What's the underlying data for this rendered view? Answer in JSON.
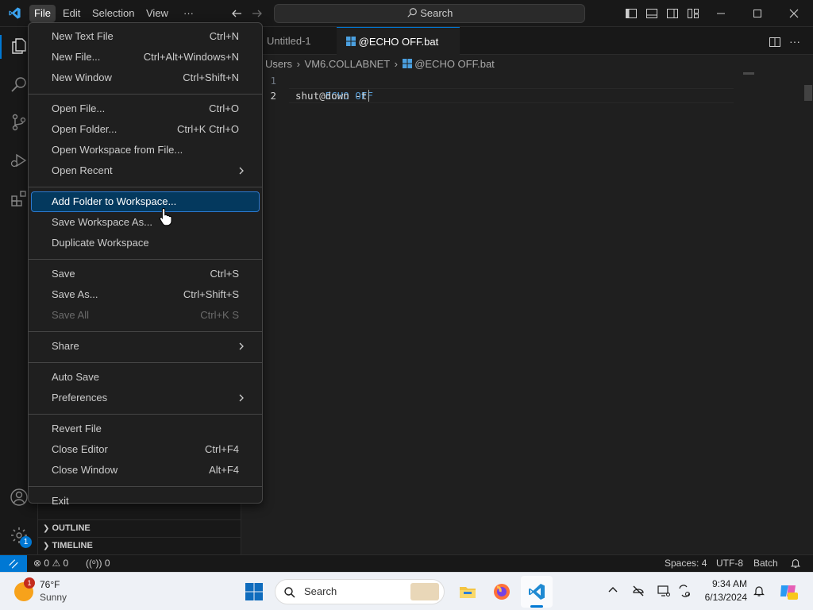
{
  "menubar": {
    "items": [
      {
        "label": "File",
        "active": true
      },
      {
        "label": "Edit"
      },
      {
        "label": "Selection"
      },
      {
        "label": "View"
      },
      {
        "label": "···"
      }
    ],
    "search_label": "Search"
  },
  "tabs": [
    {
      "label": "Untitled-1",
      "active": false
    },
    {
      "label": "@ECHO OFF.bat",
      "active": true
    }
  ],
  "breadcrumb": [
    "Users",
    "VM6.COLLABNET",
    "@ECHO OFF.bat"
  ],
  "editor": {
    "lines": [
      {
        "num": "1",
        "at": "@",
        "kw": "ECHO OFF"
      },
      {
        "num": "2",
        "text": "shut down -t"
      }
    ]
  },
  "sidebar": {
    "sections": [
      "OUTLINE",
      "TIMELINE"
    ]
  },
  "file_menu": {
    "groups": [
      [
        {
          "label": "New Text File",
          "shortcut": "Ctrl+N"
        },
        {
          "label": "New File...",
          "shortcut": "Ctrl+Alt+Windows+N"
        },
        {
          "label": "New Window",
          "shortcut": "Ctrl+Shift+N"
        }
      ],
      [
        {
          "label": "Open File...",
          "shortcut": "Ctrl+O"
        },
        {
          "label": "Open Folder...",
          "shortcut": "Ctrl+K Ctrl+O"
        },
        {
          "label": "Open Workspace from File...",
          "shortcut": ""
        },
        {
          "label": "Open Recent",
          "shortcut": "",
          "submenu": true
        }
      ],
      [
        {
          "label": "Add Folder to Workspace...",
          "shortcut": "",
          "selected": true
        },
        {
          "label": "Save Workspace As...",
          "shortcut": ""
        },
        {
          "label": "Duplicate Workspace",
          "shortcut": ""
        }
      ],
      [
        {
          "label": "Save",
          "shortcut": "Ctrl+S"
        },
        {
          "label": "Save As...",
          "shortcut": "Ctrl+Shift+S"
        },
        {
          "label": "Save All",
          "shortcut": "Ctrl+K S",
          "disabled": true
        }
      ],
      [
        {
          "label": "Share",
          "shortcut": "",
          "submenu": true
        }
      ],
      [
        {
          "label": "Auto Save",
          "shortcut": ""
        },
        {
          "label": "Preferences",
          "shortcut": "",
          "submenu": true
        }
      ],
      [
        {
          "label": "Revert File",
          "shortcut": ""
        },
        {
          "label": "Close Editor",
          "shortcut": "Ctrl+F4"
        },
        {
          "label": "Close Window",
          "shortcut": "Alt+F4"
        }
      ],
      [
        {
          "label": "Exit",
          "shortcut": ""
        }
      ]
    ]
  },
  "statusbar": {
    "errors": "0",
    "warnings": "0",
    "ports": "0",
    "spaces": "Spaces: 4",
    "encoding": "UTF-8",
    "language": "Batch"
  },
  "taskbar": {
    "weather_temp": "76°F",
    "weather_desc": "Sunny",
    "weather_badge": "1",
    "search_label": "Search",
    "time": "9:34 AM",
    "date": "6/13/2024"
  },
  "accounts_badge": "1",
  "colors": {
    "accent": "#0078d4",
    "menu_selection": "#04395e",
    "remote_button": "#0078d4",
    "keyword": "#569cd6"
  }
}
